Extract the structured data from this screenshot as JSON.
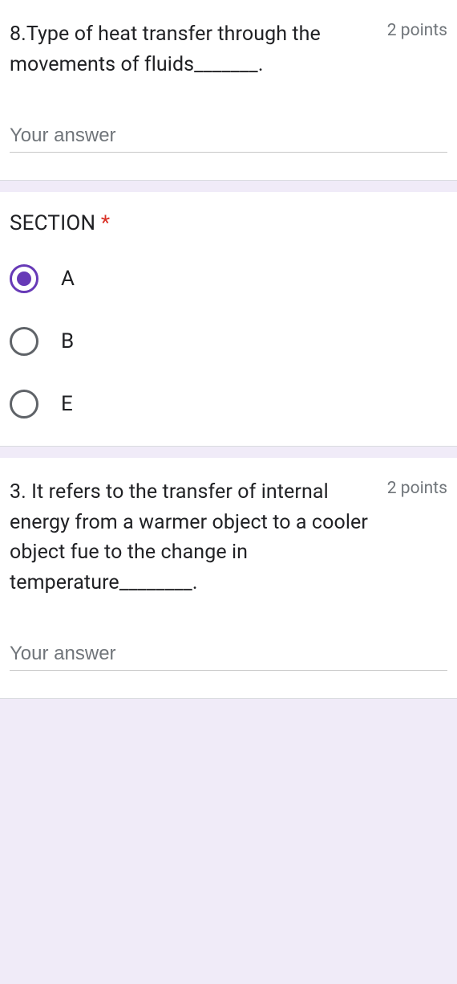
{
  "question1": {
    "text": "8.Type of heat transfer through the movements of fluids_______.",
    "points": "2 points",
    "placeholder": "Your answer"
  },
  "section": {
    "title": "SECTION ",
    "required": "*",
    "options": [
      {
        "label": "A",
        "selected": true
      },
      {
        "label": "B",
        "selected": false
      },
      {
        "label": "E",
        "selected": false
      }
    ]
  },
  "question2": {
    "text": "3. It refers to the transfer of internal energy from a warmer object to a cooler object fue to the change in temperature________.",
    "points": "2 points",
    "placeholder": "Your answer"
  }
}
